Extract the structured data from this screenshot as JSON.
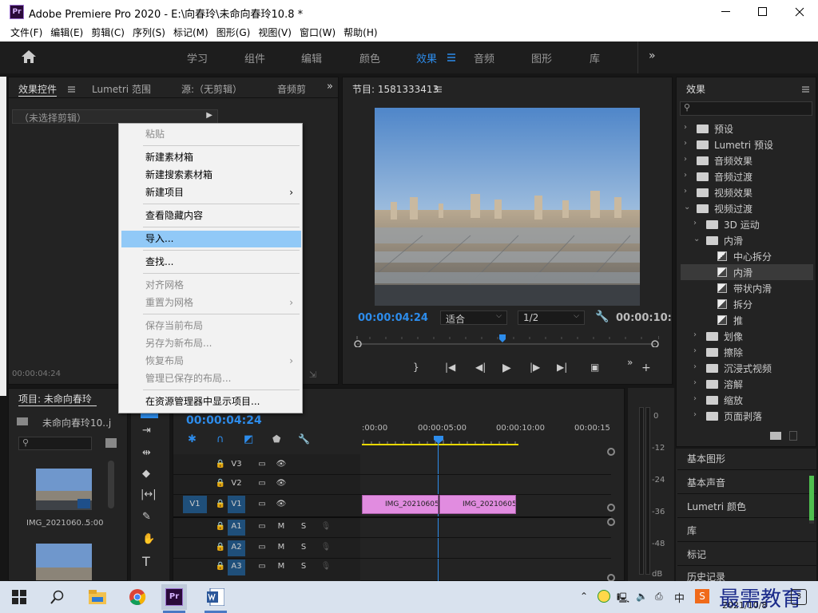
{
  "window": {
    "title": "Adobe Premiere Pro 2020 - E:\\向春玲\\未命向春玲10.8 *",
    "logo": "Pr"
  },
  "menu": [
    "文件(F)",
    "编辑(E)",
    "剪辑(C)",
    "序列(S)",
    "标记(M)",
    "图形(G)",
    "视图(V)",
    "窗口(W)",
    "帮助(H)"
  ],
  "workspaces": [
    "学习",
    "组件",
    "编辑",
    "颜色",
    "效果",
    "音频",
    "图形",
    "库"
  ],
  "active_workspace": "效果",
  "source_panel": {
    "tabs": [
      "效果控件",
      "Lumetri 范围",
      "源:（无剪辑）",
      "音频剪"
    ],
    "no_clip": "（未选择剪辑）",
    "timecode": "00:00:04:24"
  },
  "program": {
    "title": "节目: 1581333413",
    "timecode": "00:00:04:24",
    "fit": "适合",
    "quality": "1/2",
    "end_tc": "00:00:10:"
  },
  "context_menu": {
    "items": [
      "粘贴",
      "新建素材箱",
      "新建搜索素材箱",
      "新建项目",
      "查看隐藏内容",
      "导入...",
      "查找...",
      "对齐网格",
      "重置为网格",
      "保存当前布局",
      "另存为新布局...",
      "恢复布局",
      "管理已保存的布局...",
      "在资源管理器中显示项目..."
    ]
  },
  "project": {
    "tab": "项目: 未命向春玲",
    "file": "未命向春玲10..j",
    "clip_name": "IMG_2021060...",
    "clip_duration": "5:00"
  },
  "timeline": {
    "timecode": "00:00:04:24",
    "ruler": [
      ":00:00",
      "00:00:05:00",
      "00:00:10:00",
      "00:00:15"
    ],
    "video_tracks": [
      "V3",
      "V2",
      "V1"
    ],
    "audio_tracks": [
      "A1",
      "A2",
      "A3"
    ],
    "source_patch": "V1",
    "clips": [
      "IMG_20210605",
      "IMG_20210605"
    ],
    "track_letters": {
      "m": "M",
      "s": "S"
    }
  },
  "meter": {
    "labels": [
      "0",
      "-12",
      "-24",
      "-36",
      "-48",
      "dB"
    ]
  },
  "effects": {
    "title": "效果",
    "tree": [
      "预设",
      "Lumetri 预设",
      "音频效果",
      "音频过渡",
      "视频效果",
      "视频过渡",
      "3D 运动",
      "内滑",
      "中心拆分",
      "内滑",
      "带状内滑",
      "拆分",
      "推",
      "划像",
      "擦除",
      "沉浸式视频",
      "溶解",
      "缩放",
      "页面剥落"
    ]
  },
  "side_panels": [
    "基本图形",
    "基本声音",
    "Lumetri 颜色",
    "库",
    "标记",
    "历史记录"
  ],
  "taskbar": {
    "ime": "中",
    "time": "2021/10/8",
    "watermark": "最需教育",
    "notify": "3"
  },
  "colors": {
    "accent": "#2d8ceb",
    "clip": "#e18ce0",
    "highlight": "#91c9f7",
    "playhead": "#2d8ceb"
  }
}
